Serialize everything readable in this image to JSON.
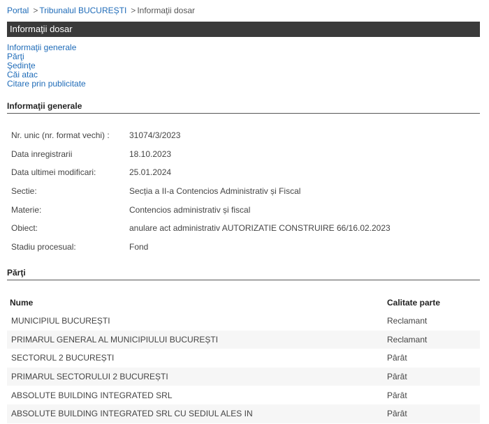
{
  "breadcrumb": {
    "items": [
      "Portal",
      "Tribunalul BUCUREȘTI",
      "Informaţii dosar"
    ],
    "separator": ">"
  },
  "page_title": "Informaţii dosar",
  "nav": [
    "Informaţii generale",
    "Părţi",
    "Şedinţe",
    "Căi atac",
    "Citare prin publicitate"
  ],
  "general": {
    "heading": "Informaţii generale",
    "rows": [
      {
        "label": "Nr. unic (nr. format vechi) :",
        "value": "31074/3/2023"
      },
      {
        "label": "Data inregistrarii",
        "value": "18.10.2023"
      },
      {
        "label": "Data ultimei modificari:",
        "value": "25.01.2024"
      },
      {
        "label": "Sectie:",
        "value": "Secția a II-a Contencios Administrativ și Fiscal"
      },
      {
        "label": "Materie:",
        "value": "Contencios administrativ și fiscal"
      },
      {
        "label": "Obiect:",
        "value": "anulare act administrativ AUTORIZATIE CONSTRUIRE 66/16.02.2023"
      },
      {
        "label": "Stadiu procesual:",
        "value": "Fond"
      }
    ]
  },
  "parties": {
    "heading": "Părţi",
    "columns": [
      "Nume",
      "Calitate parte"
    ],
    "rows": [
      {
        "name": "MUNICIPIUL BUCUREȘTI",
        "role": "Reclamant"
      },
      {
        "name": "PRIMARUL GENERAL AL MUNICIPIULUI BUCUREȘTI",
        "role": "Reclamant"
      },
      {
        "name": "SECTORUL 2 BUCUREȘTI",
        "role": "Pârât"
      },
      {
        "name": "PRIMARUL SECTORULUI 2 BUCUREȘTI",
        "role": "Pârât"
      },
      {
        "name": "ABSOLUTE BUILDING INTEGRATED SRL",
        "role": "Pârât"
      },
      {
        "name": "ABSOLUTE BUILDING INTEGRATED SRL CU SEDIUL ALES IN",
        "role": "Pârât"
      }
    ]
  }
}
